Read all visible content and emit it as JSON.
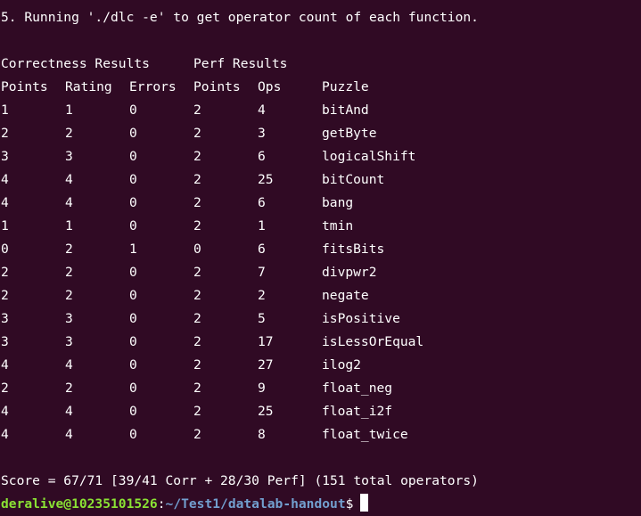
{
  "terminal": {
    "step_line": "5. Running './dlc -e' to get operator count of each function.",
    "section_correctness": "Correctness Results",
    "section_perf": "Perf Results",
    "headers": [
      "Points",
      "Rating",
      "Errors",
      "Points",
      "Ops",
      "Puzzle"
    ],
    "rows": [
      [
        "1",
        "1",
        "0",
        "2",
        "4",
        "bitAnd"
      ],
      [
        "2",
        "2",
        "0",
        "2",
        "3",
        "getByte"
      ],
      [
        "3",
        "3",
        "0",
        "2",
        "6",
        "logicalShift"
      ],
      [
        "4",
        "4",
        "0",
        "2",
        "25",
        "bitCount"
      ],
      [
        "4",
        "4",
        "0",
        "2",
        "6",
        "bang"
      ],
      [
        "1",
        "1",
        "0",
        "2",
        "1",
        "tmin"
      ],
      [
        "0",
        "2",
        "1",
        "0",
        "6",
        "fitsBits"
      ],
      [
        "2",
        "2",
        "0",
        "2",
        "7",
        "divpwr2"
      ],
      [
        "2",
        "2",
        "0",
        "2",
        "2",
        "negate"
      ],
      [
        "3",
        "3",
        "0",
        "2",
        "5",
        "isPositive"
      ],
      [
        "3",
        "3",
        "0",
        "2",
        "17",
        "isLessOrEqual"
      ],
      [
        "4",
        "4",
        "0",
        "2",
        "27",
        "ilog2"
      ],
      [
        "2",
        "2",
        "0",
        "2",
        "9",
        "float_neg"
      ],
      [
        "4",
        "4",
        "0",
        "2",
        "25",
        "float_i2f"
      ],
      [
        "4",
        "4",
        "0",
        "2",
        "8",
        "float_twice"
      ]
    ],
    "score_line": "Score = 67/71 [39/41 Corr + 28/30 Perf] (151 total operators)",
    "prompt": {
      "user_host": "deralive@10235101526",
      "separator": ":",
      "path": "~/Test1/datalab-handout",
      "symbol": "$"
    },
    "colors": {
      "background": "#300a24",
      "text": "#ffffff",
      "prompt_user": "#8ae234",
      "prompt_path": "#729fcf"
    }
  }
}
